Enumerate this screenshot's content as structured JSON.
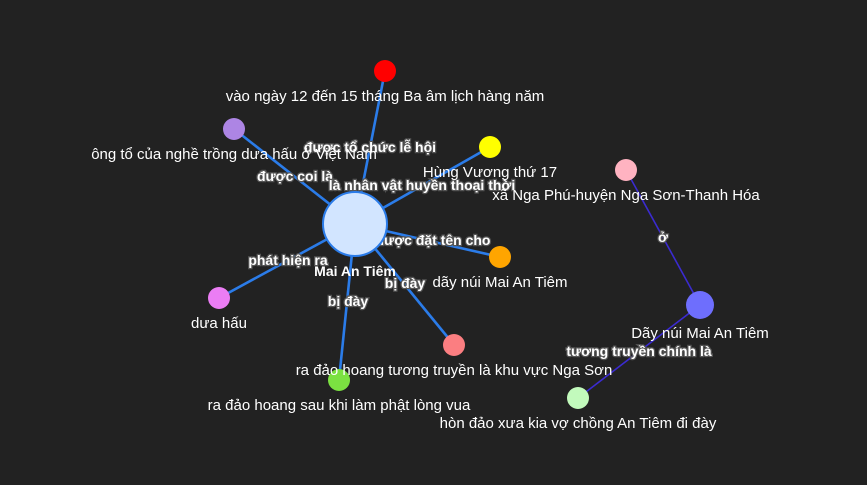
{
  "graph": {
    "nodes": [
      {
        "id": "center",
        "label": "Mai An Tiêm",
        "color": "#d2e5ff"
      },
      {
        "id": "n1",
        "label": "vào ngày 12 đến 15 tháng Ba âm lịch hàng năm",
        "color": "#ff0000"
      },
      {
        "id": "n2",
        "label": "ông tổ của nghề trồng dưa hấu ở Việt Nam",
        "color": "#ad85e4"
      },
      {
        "id": "n3",
        "label": "Hùng Vương thứ 17",
        "color": "#ffff00"
      },
      {
        "id": "n4",
        "label": "dãy núi Mai An Tiêm",
        "color": "#ffa500"
      },
      {
        "id": "n5",
        "label": "dưa hấu",
        "color": "#eb7df4"
      },
      {
        "id": "n6",
        "label": "ra đảo hoang tương truyền là khu vực Nga Sơn",
        "color": "#fb7e81"
      },
      {
        "id": "n7",
        "label": "ra đảo hoang sau khi làm phật lòng vua",
        "color": "#7be141"
      },
      {
        "id": "n8",
        "label": "xã Nga Phú-huyện Nga Sơn-Thanh Hóa",
        "color": "#ffb3c1"
      },
      {
        "id": "n9",
        "label": "Dãy núi Mai An Tiêm",
        "color": "#6e6efd"
      },
      {
        "id": "n10",
        "label": "hòn đảo xưa kia vợ chồng An Tiêm đi đày",
        "color": "#c2fabc"
      }
    ],
    "edges": [
      {
        "from": "center",
        "to": "n1",
        "label": "được tổ chức lễ hội",
        "color": "#2b7ce9"
      },
      {
        "from": "center",
        "to": "n2",
        "label": "được coi là",
        "color": "#2b7ce9"
      },
      {
        "from": "center",
        "to": "n3",
        "label": "là nhân vật huyền thoại thời",
        "color": "#2b7ce9"
      },
      {
        "from": "center",
        "to": "n4",
        "label": "được đặt tên cho",
        "color": "#2b7ce9"
      },
      {
        "from": "center",
        "to": "n5",
        "label": "phát hiện ra",
        "color": "#2b7ce9"
      },
      {
        "from": "center",
        "to": "n6",
        "label": "bị đày",
        "color": "#2b7ce9"
      },
      {
        "from": "center",
        "to": "n7",
        "label": "bị đày",
        "color": "#2b7ce9"
      },
      {
        "from": "n9",
        "to": "n8",
        "label": "ở",
        "color": "#3b2bd0"
      },
      {
        "from": "n9",
        "to": "n10",
        "label": "tương truyền chính là",
        "color": "#3b2bd0"
      }
    ]
  }
}
